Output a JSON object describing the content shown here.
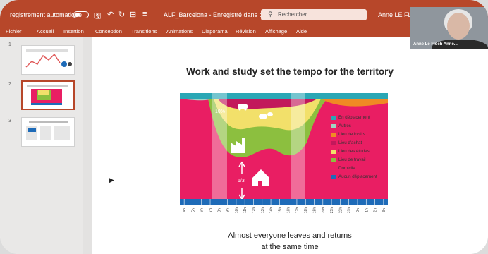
{
  "titlebar": {
    "autosave_label": "registrement automatique",
    "document_title": "ALF_Barcelona - Enregistré dans ce PC",
    "search_placeholder": "Rechercher",
    "user_name": "Anne LE FLOCH"
  },
  "ribbon": {
    "tabs": [
      "Fichier",
      "Accueil",
      "Insertion",
      "Conception",
      "Transitions",
      "Animations",
      "Diaporama",
      "Révision",
      "Affichage",
      "Aide"
    ]
  },
  "thumbnails": [
    {
      "number": "1"
    },
    {
      "number": "2",
      "active": true
    },
    {
      "number": "3"
    }
  ],
  "slide": {
    "title": "Work and study set the tempo for the territory",
    "caption_line1": "Almost everyone leaves and returns",
    "caption_line2": "at the same time",
    "percent_label": "10%",
    "ratio_label": "1/3"
  },
  "legend": [
    {
      "label": "En déplacement",
      "color": "#2aa7b5"
    },
    {
      "label": "Autres",
      "color": "#9fd3c4"
    },
    {
      "label": "Lieu de loisirs",
      "color": "#f08a24"
    },
    {
      "label": "Lieu d'achat",
      "color": "#c2185b"
    },
    {
      "label": "Lieu des études",
      "color": "#f2e06a"
    },
    {
      "label": "Lieu de travail",
      "color": "#8cbf3f"
    },
    {
      "label": "Domicile",
      "color": "#e91e63"
    },
    {
      "label": "Aucun déplacement",
      "color": "#1e6bb8"
    }
  ],
  "time_axis": [
    "4h",
    "5h",
    "6h",
    "7h",
    "8h",
    "9h",
    "10h",
    "11h",
    "12h",
    "13h",
    "14h",
    "15h",
    "16h",
    "17h",
    "18h",
    "19h",
    "20h",
    "21h",
    "22h",
    "23h",
    "0h",
    "1h",
    "2h",
    "3h"
  ],
  "webcam": {
    "name_label": "Anne Le Floch Anne..."
  }
}
